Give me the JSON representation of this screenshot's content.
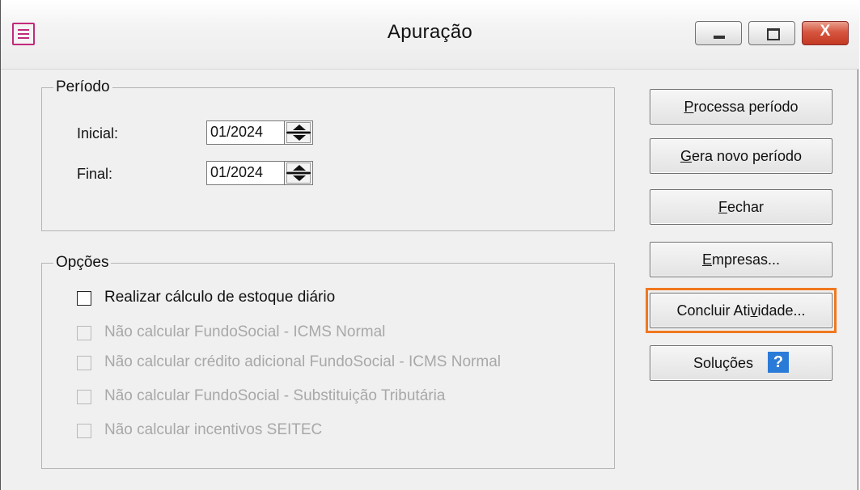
{
  "window": {
    "title": "Apuração",
    "close_glyph": "X"
  },
  "periodo": {
    "legend": "Período",
    "inicial_label": "Inicial:",
    "inicial_value": "01/2024",
    "final_label": "Final:",
    "final_value": "01/2024"
  },
  "opcoes": {
    "legend": "Opções",
    "items": [
      {
        "label": "Realizar cálculo de estoque diário",
        "checked": false,
        "enabled": true
      },
      {
        "label": "Não calcular FundoSocial - ICMS Normal",
        "checked": false,
        "enabled": false
      },
      {
        "label": "Não calcular crédito adicional FundoSocial - ICMS Normal",
        "checked": false,
        "enabled": false
      },
      {
        "label": "Não calcular FundoSocial - Substituição Tributária",
        "checked": false,
        "enabled": false
      },
      {
        "label": "Não calcular incentivos SEITEC",
        "checked": false,
        "enabled": false
      }
    ]
  },
  "buttons": {
    "processa": {
      "first": "P",
      "rest": "rocessa período"
    },
    "gera": {
      "first": "G",
      "rest": "era novo período"
    },
    "fechar": {
      "first": "F",
      "rest": "echar"
    },
    "empresas": {
      "first": "E",
      "rest": "mpresas..."
    },
    "concluir": {
      "pre": "Concluir Ati",
      "ul": "v",
      "post": "idade..."
    },
    "solucoes": {
      "label": "Soluções",
      "help_glyph": "?"
    }
  },
  "colors": {
    "focus_ring": "#f07820",
    "help_icon": "#2a7ad8",
    "app_icon": "#c12a7a",
    "close_button": "#c43a23"
  }
}
